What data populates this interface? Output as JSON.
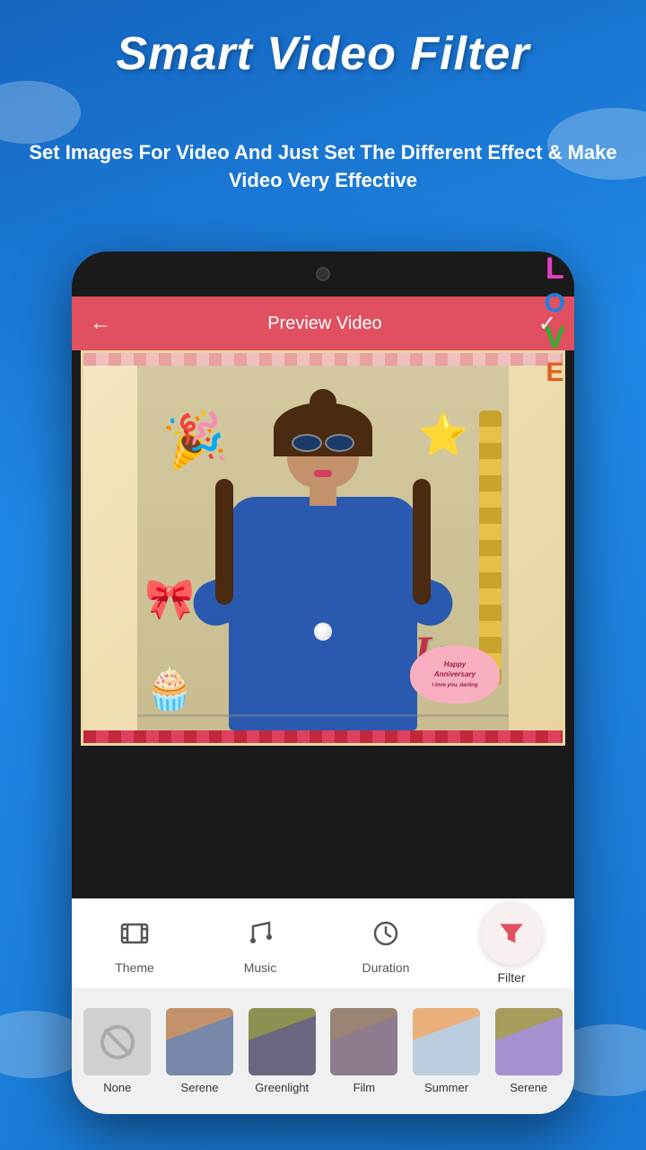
{
  "app": {
    "title": "Smart Video Filter",
    "subtitle": "Set Images For Video And Just Set The Different Effect & Make Video Very Effective"
  },
  "preview_bar": {
    "title": "Preview Video",
    "back_icon": "←",
    "check_icon": "✓"
  },
  "toolbar": {
    "items": [
      {
        "id": "theme",
        "label": "Theme",
        "icon": "film"
      },
      {
        "id": "music",
        "label": "Music",
        "icon": "music"
      },
      {
        "id": "duration",
        "label": "Duration",
        "icon": "clock"
      },
      {
        "id": "filter",
        "label": "Filter",
        "icon": "filter",
        "active": true
      }
    ]
  },
  "filters": [
    {
      "id": "none",
      "label": "None",
      "type": "none"
    },
    {
      "id": "serene",
      "label": "Serene",
      "type": "serene"
    },
    {
      "id": "greenlight",
      "label": "Greenlight",
      "type": "greenlight"
    },
    {
      "id": "film",
      "label": "Film",
      "type": "film"
    },
    {
      "id": "summer",
      "label": "Summer",
      "type": "summer"
    },
    {
      "id": "serene2",
      "label": "Serene",
      "type": "serene2"
    }
  ],
  "love_sticker": {
    "letters": [
      "L",
      "O",
      "V",
      "E"
    ]
  },
  "anniversary": {
    "line1": "Happy",
    "line2": "Anniversary",
    "line3": "I love you, darling"
  }
}
